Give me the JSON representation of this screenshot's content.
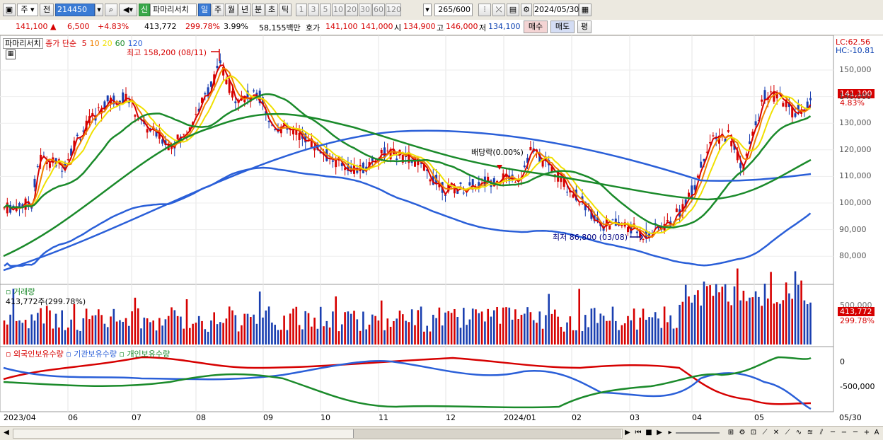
{
  "toolbar": {
    "period_select": "주",
    "prev_label": "전",
    "code": "214450",
    "new_badge": "신",
    "stock_name": "파마리서치",
    "interval_tabs": [
      "일",
      "주",
      "월",
      "년",
      "분",
      "초",
      "틱"
    ],
    "number_tabs": [
      "1",
      "3",
      "5",
      "10",
      "20",
      "30",
      "60",
      "120"
    ],
    "count": "265",
    "count_total": "/600",
    "date": "2024/05/30"
  },
  "infobar": {
    "price": "141,100",
    "change": "6,500",
    "change_pct": "+4.83%",
    "volume": "413,772",
    "volume_ratio": "299.78%",
    "turnover": "3.99%",
    "amount": "58,155백만",
    "bid_label": "호가",
    "bid": "141,100",
    "ask": "141,000",
    "open_label": "시",
    "open": "134,900",
    "high_label": "고",
    "high": "146,000",
    "low_label": "저",
    "low": "134,100",
    "buy_button": "매수",
    "sell_button": "매도",
    "eval_button": "평"
  },
  "legend": {
    "stock": "파마리서치",
    "ma_label": "종가 단순",
    "ma_periods": [
      "5",
      "10",
      "20",
      "60",
      "120"
    ],
    "ma_colors": [
      "#d60000",
      "#f08000",
      "#f0e000",
      "#1a8a2a",
      "#2a5fd8"
    ],
    "volume_title": "거래량",
    "volume_value": "413,772주(299.78%)",
    "holders": [
      "외국인보유수량",
      "기관보유수량",
      "개인보유수량"
    ]
  },
  "annotations": {
    "high": "최고 158,200 (08/11)",
    "low": "최저 86,800 (03/08)",
    "dividend": "배당락(0.00%)",
    "lc": "LC:62.56",
    "hc": "HC:-10.81",
    "last_price": "141,100",
    "last_pct": "4.83%",
    "vol_last": "413,772",
    "vol_pct": "299.78%"
  },
  "axes": {
    "price_ticks": [
      "150,000",
      "140,000",
      "130,000",
      "120,000",
      "110,000",
      "100,000",
      "90,000",
      "80,000"
    ],
    "volume_ticks": [
      "500,000"
    ],
    "holder_ticks": [
      "0",
      "-500,000"
    ],
    "x_labels": [
      "2023/04",
      "06",
      "07",
      "08",
      "09",
      "10",
      "11",
      "12",
      "2024/01",
      "02",
      "03",
      "04",
      "05",
      "05/30"
    ]
  },
  "colors": {
    "up": "#d60000",
    "down": "#1a3fb0",
    "foreign": "#d60000",
    "institution": "#2a5fd8",
    "individual": "#1a8a2a"
  }
}
